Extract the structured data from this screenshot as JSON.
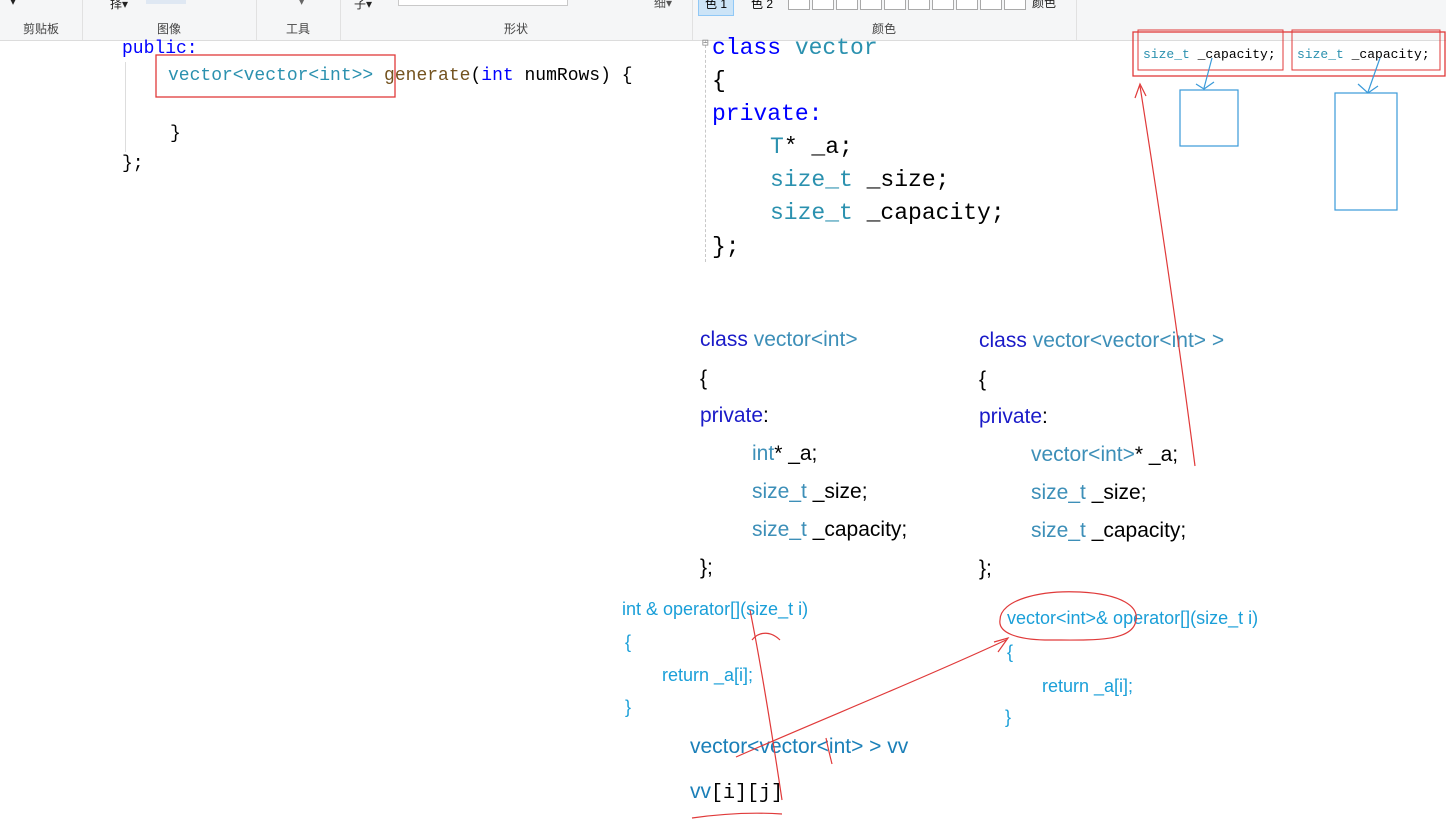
{
  "ribbon": {
    "groups": {
      "clipboard": "剪贴板",
      "image": "图像",
      "tools": "工具",
      "shapes": "形状",
      "colors": "颜色"
    },
    "select_label": "择▾",
    "width_label": "细▾",
    "text_label": "子▾",
    "color1": "色 1",
    "color2": "色 2",
    "edit_colors": "颜色"
  },
  "left_code": {
    "line1": "public:",
    "line2_type": "vector<vector<int>>",
    "line2_fn": "generate",
    "line2_param_type": "int",
    "line2_rest": " numRows) {",
    "line3": "}",
    "line4": "};"
  },
  "template_class": {
    "l1_kw": "class",
    "l1_name": " vector",
    "l2": "{",
    "l3": "private:",
    "l4_t": "T",
    "l4_rest": "* _a;",
    "l5_t": "size_t",
    "l5_rest": " _size;",
    "l6_t": "size_t",
    "l6_rest": " _capacity;",
    "l7": "};"
  },
  "thumb_code": {
    "left": {
      "type": "size_t",
      "name": " _capacity;"
    },
    "right": {
      "type": "size_t",
      "name": " _capacity;"
    }
  },
  "vec_int": {
    "title_kw": "class",
    "title_rest": " vector<int>",
    "open": "{",
    "private": "private",
    "colon": ":",
    "m1_type": "int",
    "m1_rest": "* _a;",
    "m2_type": "size_t",
    "m2_rest": " _size;",
    "m3_type": "size_t",
    "m3_rest": " _capacity;",
    "close": "};",
    "op_type": "int",
    "op_sig": " & operator[](size_t i)",
    "op_open": "{",
    "op_body": "return _a[i];",
    "op_close": "}"
  },
  "vec_vec": {
    "title_kw": "class",
    "title_rest": " vector<vector<int> >",
    "open": "{",
    "private": "private",
    "colon": ":",
    "m1_type": "vector<int>",
    "m1_rest": "* _a;",
    "m2_type": "size_t",
    "m2_rest": " _size;",
    "m3_type": "size_t",
    "m3_rest": " _capacity;",
    "close": "};",
    "op_sig": "vector<int>& operator[](size_t i)",
    "op_open": "{",
    "op_body": "return _a[i];",
    "op_close": "}"
  },
  "usage": {
    "decl": "vector<vector<int> > vv",
    "access_name": "vv",
    "access_idx": "[i][j]"
  },
  "colors": {
    "keyword": "#0000ff",
    "type": "#2b91af",
    "function": "#74531f",
    "annotation_keyword": "#1a1ac8",
    "annotation_type": "#3d8fb8",
    "annotation_blue": "#1a9fd8",
    "ink_red": "#e03a3a",
    "ink_blue": "#3a9ad9"
  }
}
